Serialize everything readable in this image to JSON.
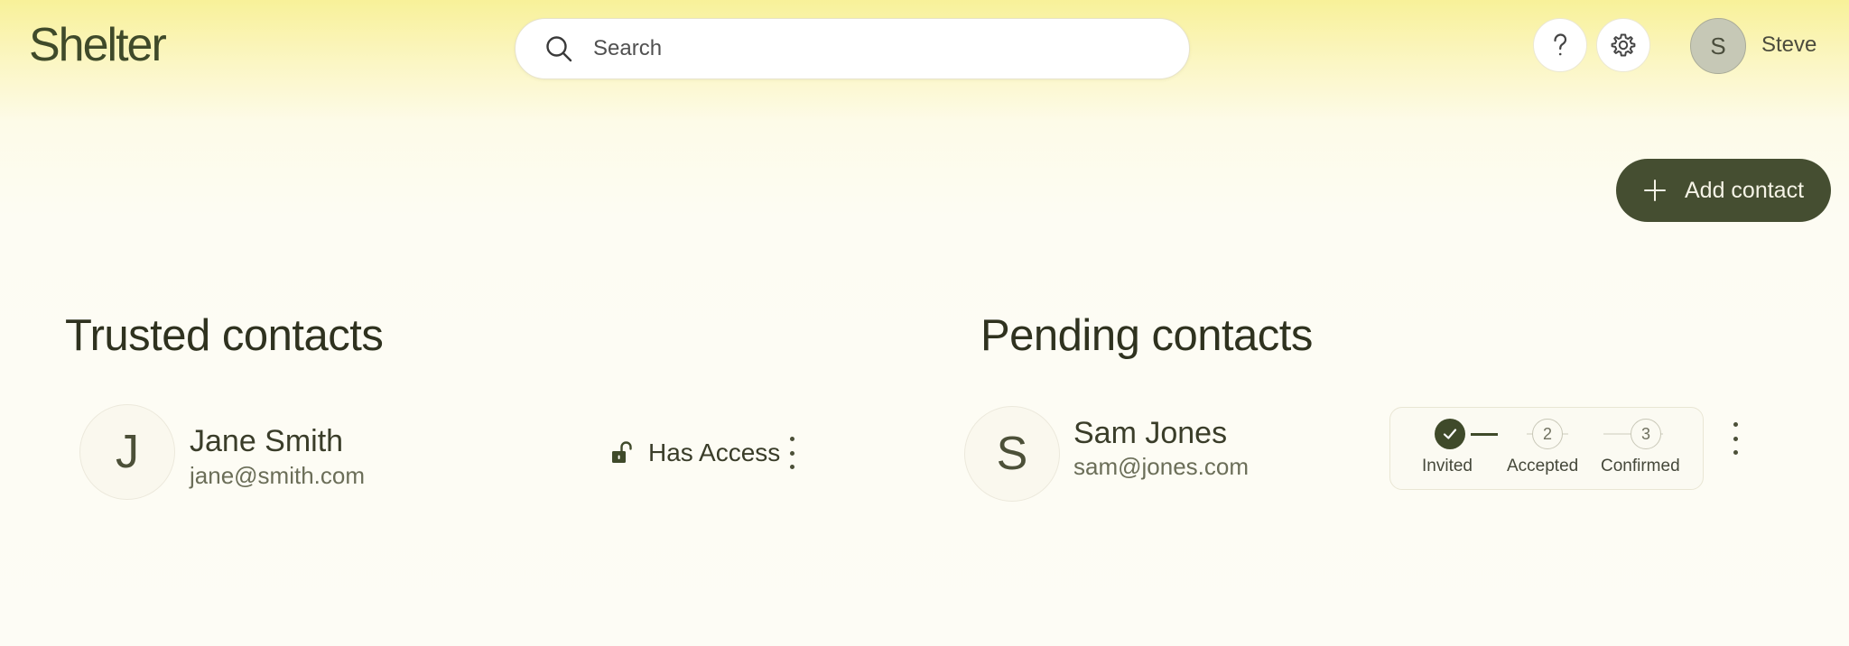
{
  "app": {
    "logo_text": "Shelter"
  },
  "header": {
    "search_placeholder": "Search",
    "user_initial": "S",
    "user_name": "Steve"
  },
  "actions": {
    "add_contact_label": "Add contact"
  },
  "trusted": {
    "title": "Trusted contacts",
    "contacts": [
      {
        "initial": "J",
        "name": "Jane Smith",
        "email": "jane@smith.com",
        "access_label": "Has Access"
      }
    ]
  },
  "pending": {
    "title": "Pending contacts",
    "contacts": [
      {
        "initial": "S",
        "name": "Sam Jones",
        "email": "sam@jones.com",
        "steps": [
          {
            "label": "Invited",
            "status": "done",
            "number": ""
          },
          {
            "label": "Accepted",
            "status": "todo",
            "number": "2"
          },
          {
            "label": "Confirmed",
            "status": "todo",
            "number": "3"
          }
        ]
      }
    ]
  },
  "colors": {
    "accent_dark": "#454e31",
    "header_yellow": "#f8f199",
    "background": "#fdfcf5"
  },
  "icons": [
    "search-icon",
    "help-icon",
    "settings-gear-icon",
    "plus-icon",
    "unlocked-padlock-icon",
    "kebab-menu-icon",
    "checkmark-icon"
  ]
}
